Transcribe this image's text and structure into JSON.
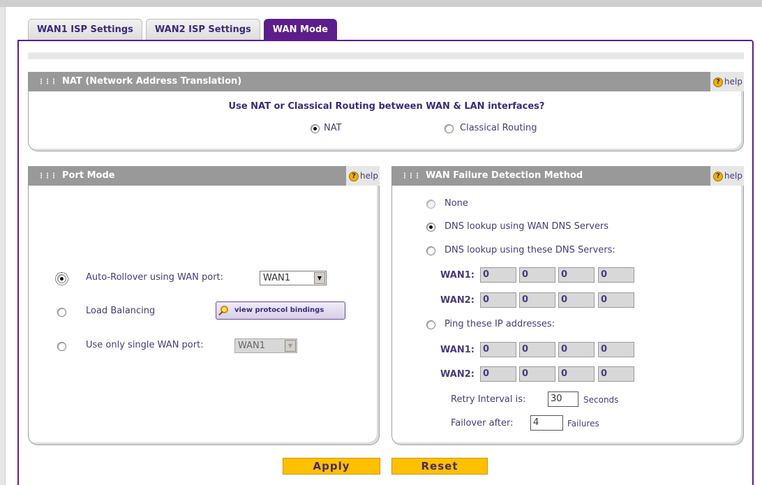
{
  "tabs": [
    "WAN1 ISP Settings",
    "WAN2 ISP Settings",
    "WAN Mode"
  ],
  "help_label": "help",
  "help_icon": "?",
  "nat": {
    "title": "NAT (Network Address Translation)",
    "question": "Use NAT or Classical Routing between WAN & LAN interfaces?",
    "option_nat": "NAT",
    "option_classical": "Classical Routing",
    "selected": "NAT"
  },
  "port_mode": {
    "title": "Port Mode",
    "auto_rollover_label": "Auto-Rollover using WAN port:",
    "auto_rollover_value": "WAN1",
    "load_balancing_label": "Load Balancing",
    "view_bindings_label": "view protocol bindings",
    "single_port_label": "Use only single WAN port:",
    "single_port_value": "WAN1",
    "selected": "Auto-Rollover"
  },
  "wan_failure": {
    "title": "WAN Failure Detection Method",
    "none_label": "None",
    "dns_wan_label": "DNS lookup using WAN DNS Servers",
    "dns_these_label": "DNS lookup using these DNS Servers:",
    "ping_label": "Ping these IP addresses:",
    "wan1_label": "WAN1:",
    "wan2_label": "WAN2:",
    "dns_wan1": [
      "0",
      "0",
      "0",
      "0"
    ],
    "dns_wan2": [
      "0",
      "0",
      "0",
      "0"
    ],
    "ping_wan1": [
      "0",
      "0",
      "0",
      "0"
    ],
    "ping_wan2": [
      "0",
      "0",
      "0",
      "0"
    ],
    "dot": ".",
    "retry_label": "Retry Interval is:",
    "retry_value": "30",
    "retry_unit": "Seconds",
    "failover_label": "Failover after:",
    "failover_value": "4",
    "failover_unit": "Failures",
    "selected": "DNS lookup using WAN DNS Servers"
  },
  "buttons": {
    "apply": "Apply",
    "reset": "Reset"
  },
  "colors": {
    "accent_purple": "#5c1e8a",
    "section_header": "#999999",
    "button_yellow": "#ffc000"
  }
}
